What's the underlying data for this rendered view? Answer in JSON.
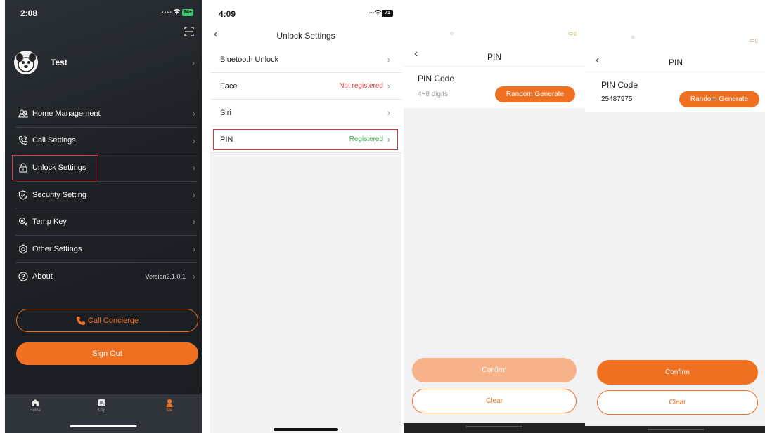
{
  "screen1": {
    "status_time": "2:08",
    "status_dots": "....",
    "battery": "74+",
    "profile_name": "Test",
    "menu": [
      {
        "label": "Home Management",
        "icon": "users-icon"
      },
      {
        "label": "Call Settings",
        "icon": "phone-icon"
      },
      {
        "label": "Unlock Settings",
        "icon": "lock-icon"
      },
      {
        "label": "Security Setting",
        "icon": "shield-icon"
      },
      {
        "label": "Temp Key",
        "icon": "key-icon"
      },
      {
        "label": "Other Settings",
        "icon": "gear-icon"
      },
      {
        "label": "About",
        "icon": "question-icon",
        "version": "Version2.1.0.1"
      }
    ],
    "concierge_label": "Call Concierge",
    "signout_label": "Sign Out",
    "tabs": [
      {
        "label": "Home",
        "icon": "home-icon"
      },
      {
        "label": "Log",
        "icon": "log-icon"
      },
      {
        "label": "Me",
        "icon": "user-icon"
      }
    ],
    "accent": "#f07022"
  },
  "screen2": {
    "status_time": "4:09",
    "status_dots": "....",
    "battery": "71",
    "title": "Unlock Settings",
    "items": [
      {
        "label": "Bluetooth Unlock",
        "status": ""
      },
      {
        "label": "Face",
        "status": "Not registered"
      },
      {
        "label": "Siri",
        "status": ""
      },
      {
        "label": "PIN",
        "status": "Registered"
      }
    ],
    "status_colors": {
      "not_registered": "#e0454a",
      "registered": "#3aa84a"
    }
  },
  "screen3": {
    "title": "PIN",
    "pin_code_label": "PIN Code",
    "pin_placeholder": "4~8 digits",
    "random_label": "Random Generate",
    "confirm_label": "Confirm",
    "clear_label": "Clear",
    "confirm_color": "#f7b28a"
  },
  "screen4": {
    "title": "PIN",
    "pin_code_label": "PIN Code",
    "pin_value": "25487975",
    "random_label": "Random Generate",
    "confirm_label": "Confirm",
    "clear_label": "Clear",
    "confirm_color": "#f07022"
  }
}
